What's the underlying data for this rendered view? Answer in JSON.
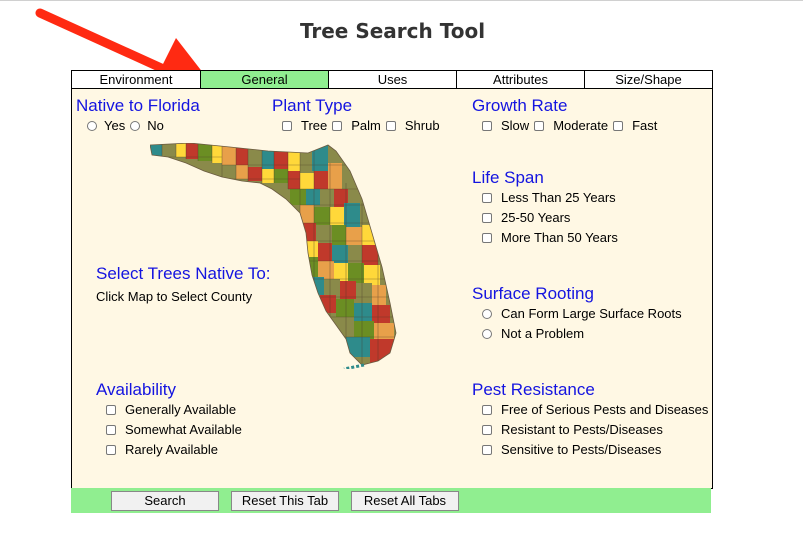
{
  "page": {
    "title": "Tree Search Tool"
  },
  "colors": {
    "tab_active": "#90ee90",
    "panel_bg": "#fff8e4",
    "heading": "#1414e0",
    "arrow": "#ff2a12"
  },
  "tabs": [
    {
      "label": "Environment",
      "active": false
    },
    {
      "label": "General",
      "active": true
    },
    {
      "label": "Uses",
      "active": false
    },
    {
      "label": "Attributes",
      "active": false
    },
    {
      "label": "Size/Shape",
      "active": false
    }
  ],
  "native": {
    "title": "Native to Florida",
    "options": [
      "Yes",
      "No"
    ]
  },
  "plant_type": {
    "title": "Plant Type",
    "options": [
      "Tree",
      "Palm",
      "Shrub"
    ]
  },
  "growth_rate": {
    "title": "Growth Rate",
    "options": [
      "Slow",
      "Moderate",
      "Fast"
    ]
  },
  "life_span": {
    "title": "Life Span",
    "options": [
      "Less Than 25 Years",
      "25-50 Years",
      "More Than 50 Years"
    ]
  },
  "map_section": {
    "title": "Select Trees Native To:",
    "hint": "Click Map to Select County"
  },
  "surface_rooting": {
    "title": "Surface Rooting",
    "options": [
      "Can Form Large Surface Roots",
      "Not a Problem"
    ]
  },
  "availability": {
    "title": "Availability",
    "options": [
      "Generally Available",
      "Somewhat Available",
      "Rarely Available"
    ]
  },
  "pest_resistance": {
    "title": "Pest Resistance",
    "options": [
      "Free of Serious Pests and Diseases",
      "Resistant to Pests/Diseases",
      "Sensitive to Pests/Diseases"
    ]
  },
  "buttons": {
    "search": "Search",
    "reset_tab": "Reset This Tab",
    "reset_all": "Reset All Tabs"
  }
}
